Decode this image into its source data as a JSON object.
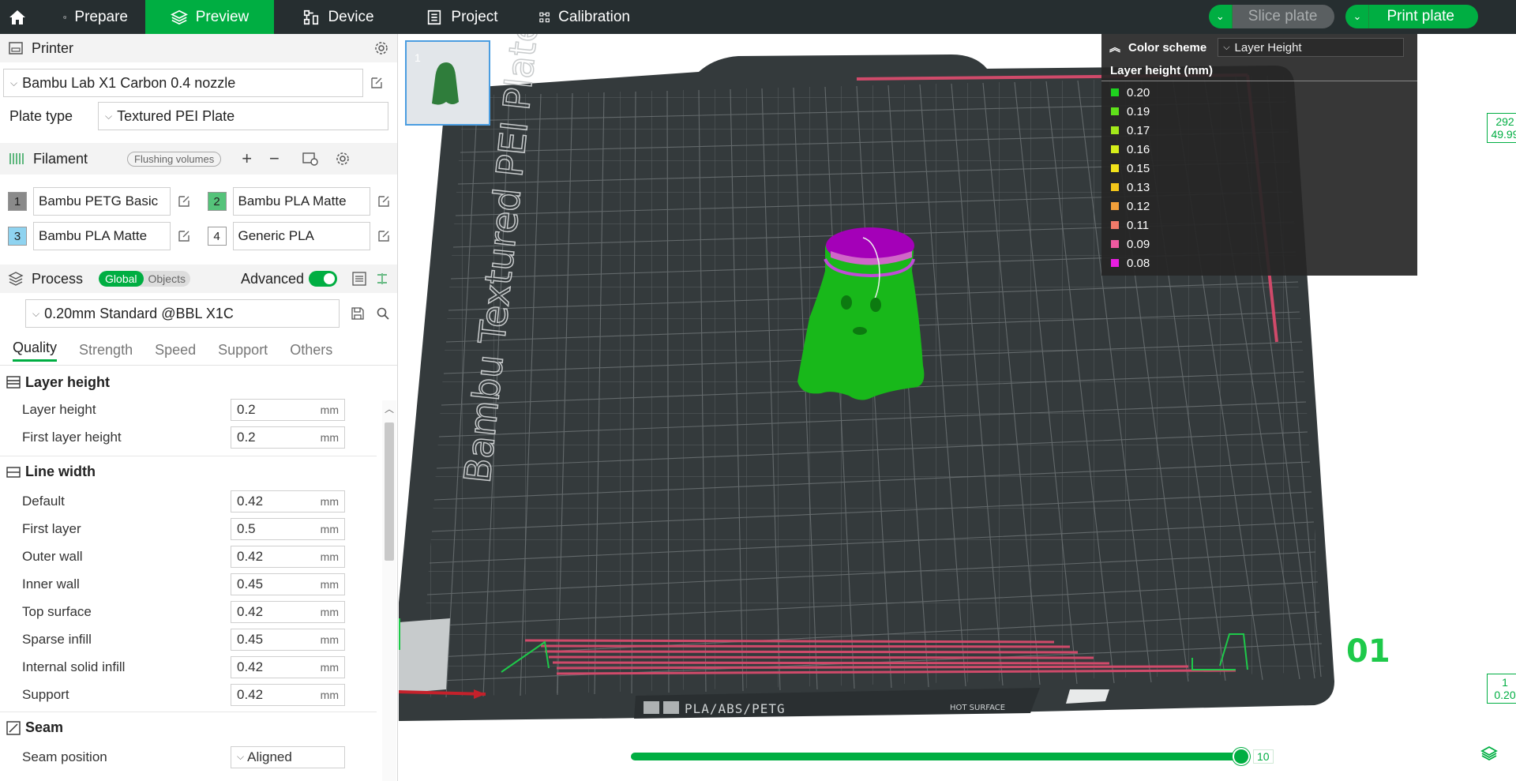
{
  "topbar": {
    "tabs": [
      {
        "label": "Prepare",
        "icon": "cube-icon"
      },
      {
        "label": "Preview",
        "icon": "layers-icon",
        "active": true
      },
      {
        "label": "Device",
        "icon": "device-icon"
      },
      {
        "label": "Project",
        "icon": "project-icon"
      },
      {
        "label": "Calibration",
        "icon": "calibration-icon"
      }
    ],
    "slice_label": "Slice plate",
    "print_label": "Print plate"
  },
  "printer": {
    "title": "Printer",
    "selected": "Bambu Lab X1 Carbon 0.4 nozzle",
    "plate_type_label": "Plate type",
    "plate_type": "Textured PEI Plate"
  },
  "filament": {
    "title": "Filament",
    "flushing_label": "Flushing volumes",
    "items": [
      {
        "num": "1",
        "name": "Bambu PETG Basic",
        "color": "#8a8a8a"
      },
      {
        "num": "2",
        "name": "Bambu PLA Matte",
        "color": "#55c37a"
      },
      {
        "num": "3",
        "name": "Bambu PLA Matte",
        "color": "#8fd3f0"
      },
      {
        "num": "4",
        "name": "Generic PLA",
        "color": "#ffffff"
      }
    ]
  },
  "process": {
    "title": "Process",
    "global_label": "Global",
    "objects_label": "Objects",
    "advanced_label": "Advanced",
    "preset": "0.20mm Standard @BBL X1C",
    "tabs": [
      "Quality",
      "Strength",
      "Speed",
      "Support",
      "Others"
    ],
    "groups": [
      {
        "title": "Layer height",
        "options": [
          {
            "label": "Layer height",
            "value": "0.2",
            "unit": "mm"
          },
          {
            "label": "First layer height",
            "value": "0.2",
            "unit": "mm"
          }
        ]
      },
      {
        "title": "Line width",
        "options": [
          {
            "label": "Default",
            "value": "0.42",
            "unit": "mm"
          },
          {
            "label": "First layer",
            "value": "0.5",
            "unit": "mm"
          },
          {
            "label": "Outer wall",
            "value": "0.42",
            "unit": "mm"
          },
          {
            "label": "Inner wall",
            "value": "0.45",
            "unit": "mm"
          },
          {
            "label": "Top surface",
            "value": "0.42",
            "unit": "mm"
          },
          {
            "label": "Sparse infill",
            "value": "0.45",
            "unit": "mm"
          },
          {
            "label": "Internal solid infill",
            "value": "0.42",
            "unit": "mm"
          },
          {
            "label": "Support",
            "value": "0.42",
            "unit": "mm"
          }
        ]
      },
      {
        "title": "Seam",
        "options": [
          {
            "label": "Seam position",
            "value": "Aligned",
            "unit": ""
          }
        ]
      }
    ]
  },
  "viewport": {
    "plate_number": "1",
    "bed_label": "Bambu Textured PEI Plate",
    "bed_material": "PLA/ABS/PETG",
    "hot_surface": "HOT SURFACE",
    "plate_id": "01",
    "legend": {
      "title": "Color scheme",
      "scheme": "Layer Height",
      "subtitle": "Layer height (mm)",
      "items": [
        {
          "value": "0.20",
          "color": "#1fd11f"
        },
        {
          "value": "0.19",
          "color": "#5fe01a"
        },
        {
          "value": "0.17",
          "color": "#a3e81a"
        },
        {
          "value": "0.16",
          "color": "#d5ee1a"
        },
        {
          "value": "0.15",
          "color": "#f1e21a"
        },
        {
          "value": "0.13",
          "color": "#f3c61a"
        },
        {
          "value": "0.12",
          "color": "#f2a03a"
        },
        {
          "value": "0.11",
          "color": "#f07a6a"
        },
        {
          "value": "0.09",
          "color": "#ef5aa0"
        },
        {
          "value": "0.08",
          "color": "#e81ee0"
        }
      ]
    },
    "layer_top": {
      "layer": "292",
      "height": "49.99"
    },
    "layer_bottom": {
      "layer": "1",
      "height": "0.20"
    },
    "move_value": "10"
  }
}
